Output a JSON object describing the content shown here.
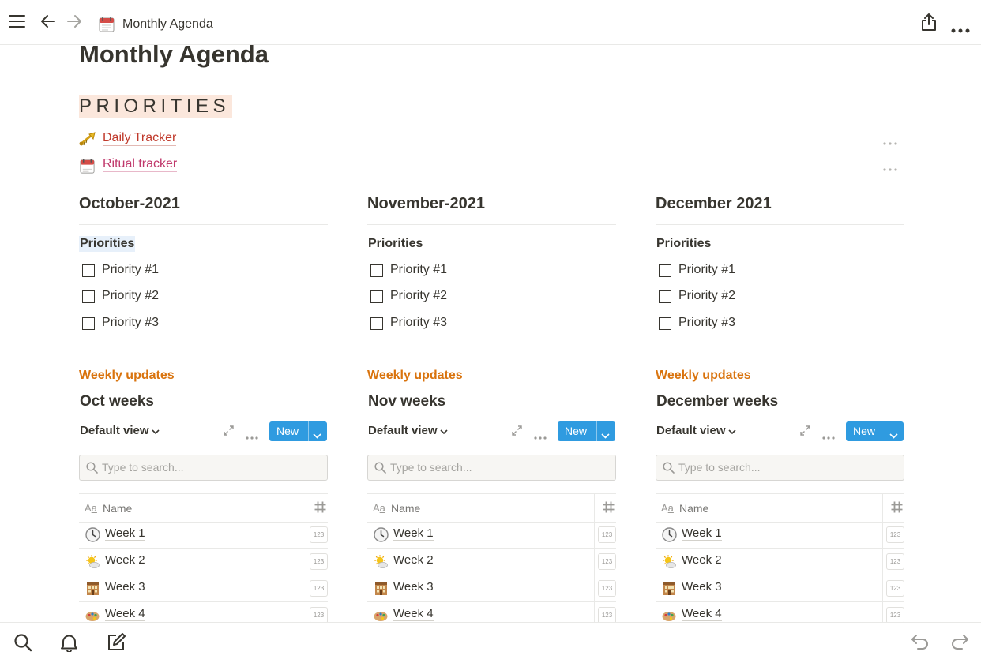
{
  "topbar": {
    "title": "Monthly Agenda",
    "icons": [
      "hamburger-icon",
      "back-arrow-icon",
      "forward-arrow-icon",
      "calendar-icon",
      "share-icon",
      "more-icon"
    ]
  },
  "page": {
    "title": "Monthly Agenda",
    "priorities_heading": "PRIORITIES",
    "links": [
      {
        "label": "Daily Tracker",
        "icon": "trumpet-icon"
      },
      {
        "label": "Ritual tracker",
        "icon": "calendar-icon"
      }
    ]
  },
  "months": [
    {
      "title": "October-2021",
      "priorities_label": "Priorities",
      "todos": [
        "Priority #1",
        "Priority #2",
        "Priority #3"
      ],
      "weekly_label": "Weekly updates",
      "db_title": "Oct weeks",
      "view_label": "Default view",
      "new_label": "New",
      "search_placeholder": "Type to search...",
      "col_name": "Name",
      "col_name_icon": "Aa",
      "rows": [
        {
          "name": "Week 1",
          "icon": "clock-icon",
          "num": "123"
        },
        {
          "name": "Week 2",
          "icon": "sun-cloud-icon",
          "num": "123"
        },
        {
          "name": "Week 3",
          "icon": "building-icon",
          "num": "123"
        },
        {
          "name": "Week 4",
          "icon": "palette-icon",
          "num": "123"
        }
      ]
    },
    {
      "title": "November-2021",
      "priorities_label": "Priorities",
      "todos": [
        "Priority #1",
        "Priority #2",
        "Priority #3"
      ],
      "weekly_label": "Weekly updates",
      "db_title": "Nov weeks",
      "view_label": "Default view",
      "new_label": "New",
      "search_placeholder": "Type to search...",
      "col_name": "Name",
      "col_name_icon": "Aa",
      "rows": [
        {
          "name": "Week 1",
          "icon": "clock-icon",
          "num": "123"
        },
        {
          "name": "Week 2",
          "icon": "sun-cloud-icon",
          "num": "123"
        },
        {
          "name": "Week 3",
          "icon": "building-icon",
          "num": "123"
        },
        {
          "name": "Week 4",
          "icon": "palette-icon",
          "num": "123"
        }
      ]
    },
    {
      "title": "December 2021",
      "priorities_label": "Priorities",
      "todos": [
        "Priority #1",
        "Priority #2",
        "Priority #3"
      ],
      "weekly_label": "Weekly updates",
      "db_title": "December weeks",
      "view_label": "Default view",
      "new_label": "New",
      "search_placeholder": "Type to search...",
      "col_name": "Name",
      "col_name_icon": "Aa",
      "rows": [
        {
          "name": "Week 1",
          "icon": "clock-icon",
          "num": "123"
        },
        {
          "name": "Week 2",
          "icon": "sun-cloud-icon",
          "num": "123"
        },
        {
          "name": "Week 3",
          "icon": "building-icon",
          "num": "123"
        },
        {
          "name": "Week 4",
          "icon": "palette-icon",
          "num": "123"
        }
      ]
    }
  ],
  "bottombar": {
    "icons": [
      "search-icon",
      "bell-icon",
      "compose-icon",
      "undo-icon",
      "redo-icon"
    ]
  },
  "colors": {
    "text": "#37352f",
    "link_red": "#c0392b",
    "link_pink": "#c0386b",
    "weekly_orange": "#d9730d",
    "new_button_blue": "#2f9be0",
    "priorities_highlight": "#fbe7dc",
    "selection_highlight": "#e7f0fa"
  }
}
